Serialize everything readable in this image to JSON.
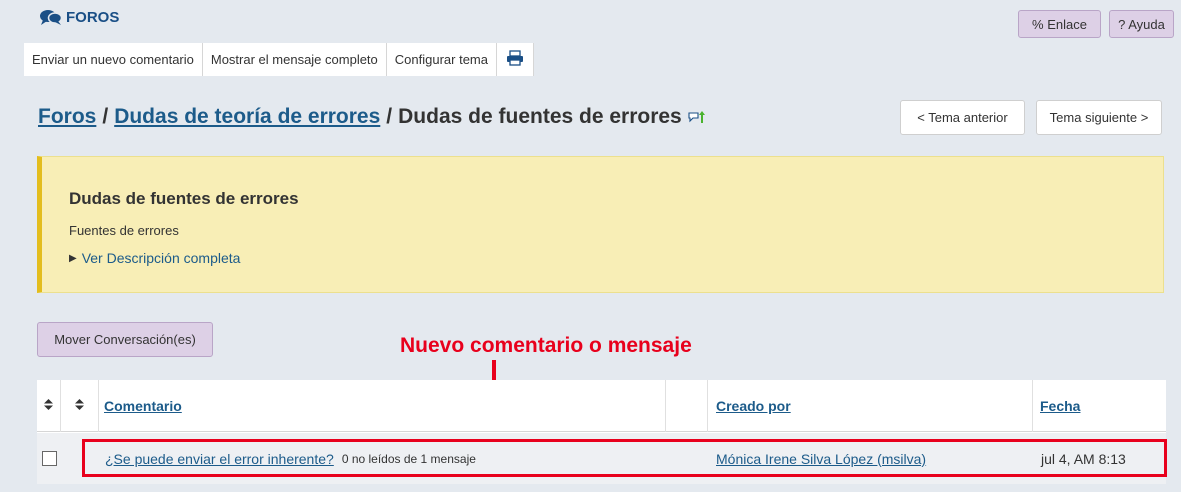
{
  "header": {
    "tool_title": "FOROS",
    "link_button": "% Enlace",
    "help_button": "? Ayuda"
  },
  "tabs": [
    {
      "label": "Enviar un nuevo comentario"
    },
    {
      "label": "Mostrar el mensaje completo"
    },
    {
      "label": "Configurar tema"
    }
  ],
  "breadcrumb": {
    "forums": "Foros ",
    "sep1": "/",
    "forum": "Dudas de teoría de errores",
    "sep2": "/",
    "topic": "Dudas de fuentes de errores"
  },
  "navigation": {
    "prev": "< Tema anterior",
    "next": "Tema siguiente >"
  },
  "topic_info": {
    "title": "Dudas de fuentes de errores",
    "subtitle": "Fuentes de errores",
    "full_description": "Ver Descripción completa"
  },
  "actions": {
    "move": "Mover Conversación(es)"
  },
  "annotation": {
    "text": "Nuevo comentario o mensaje",
    "color": "#e8001c"
  },
  "table": {
    "headers": {
      "comment": "Comentario",
      "created_by": "Creado por",
      "date": "Fecha"
    },
    "rows": [
      {
        "comment": "¿Se puede enviar el error inherente?",
        "unread": "0 no leídos de 1 mensaje",
        "created_by": "Mónica Irene Silva López (msilva)",
        "date": "jul 4, AM 8:13"
      }
    ]
  },
  "colors": {
    "link": "#1c5b8a",
    "info_background": "#f8eeb6",
    "info_border": "#e3bd1d",
    "button_purple": "#ddd0e6"
  }
}
